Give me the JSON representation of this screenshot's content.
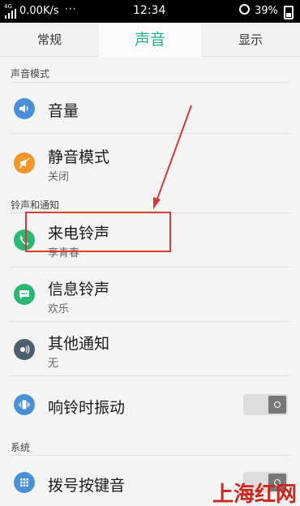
{
  "status_bar": {
    "network_badge": "4G",
    "speed": "0.00K/s",
    "dots": "···",
    "time": "12:34",
    "battery": "39%"
  },
  "tabs": [
    {
      "label": "常规",
      "active": false
    },
    {
      "label": "声音",
      "active": true
    },
    {
      "label": "显示",
      "active": false
    }
  ],
  "sections": {
    "sound_mode": "声音模式",
    "ringtones": "铃声和通知",
    "system": "系统"
  },
  "rows": {
    "volume": {
      "title": "音量",
      "icon": "volume-icon"
    },
    "silent": {
      "title": "静音模式",
      "sub": "关闭",
      "icon": "silent-mode-icon"
    },
    "ringtone": {
      "title": "来电铃声",
      "sub": "享青春",
      "icon": "phone-icon"
    },
    "message": {
      "title": "信息铃声",
      "sub": "欢乐",
      "icon": "message-icon"
    },
    "other": {
      "title": "其他通知",
      "sub": "无",
      "icon": "notification-icon"
    },
    "vibrate": {
      "title": "响铃时振动",
      "icon": "vibrate-icon",
      "toggle": "off"
    },
    "dial": {
      "title": "拨号按键音",
      "icon": "dialpad-icon",
      "toggle": "off"
    }
  },
  "colors": {
    "accent": "#1fb48a",
    "icon_blue": "#4a90d9",
    "icon_orange": "#f0962b",
    "icon_green": "#2bb673",
    "icon_dark": "#4c5f70",
    "annotation_red": "#d63a3a"
  },
  "watermark": "上海红网"
}
